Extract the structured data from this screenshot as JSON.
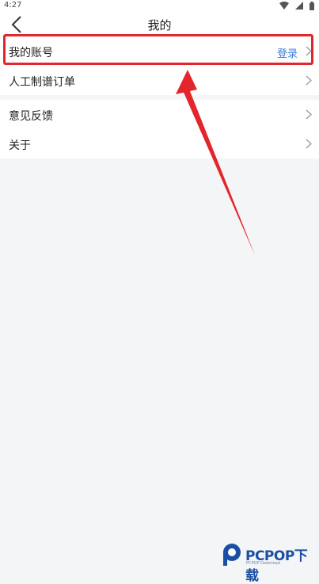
{
  "status_bar": {
    "time": "4:27",
    "icons": [
      "wifi-icon",
      "signal-icon",
      "battery-icon"
    ]
  },
  "nav": {
    "title": "我的",
    "back_icon": "back-icon"
  },
  "sections": [
    {
      "rows": [
        {
          "label": "我的账号",
          "action": "登录",
          "icon": "chevron-right-icon"
        },
        {
          "label": "人工制谱订单",
          "icon": "chevron-right-icon"
        }
      ]
    },
    {
      "rows": [
        {
          "label": "意见反馈",
          "icon": "chevron-right-icon"
        },
        {
          "label": "关于",
          "icon": "chevron-right-icon"
        }
      ]
    }
  ],
  "annotation": {
    "color": "#e3262b"
  },
  "watermark": {
    "brand": "PCPOP下载",
    "subtitle": "PCPOP Download"
  },
  "colors": {
    "accent": "#3a7bd5",
    "background": "#f4f5f7"
  }
}
